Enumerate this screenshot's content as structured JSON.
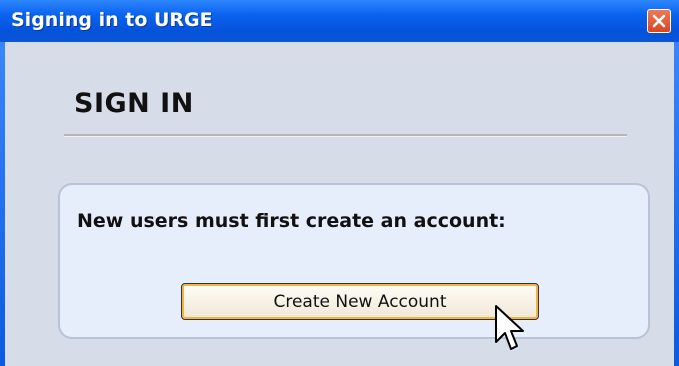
{
  "window": {
    "title": "Signing in to URGE"
  },
  "signin": {
    "heading": "SIGN IN",
    "prompt": "New users must first create an account:",
    "create_button_label": "Create New Account"
  },
  "icons": {
    "close": "close-icon",
    "cursor": "mouse-pointer-icon"
  },
  "colors": {
    "titlebar": "#0a63ee",
    "client_background": "#d6dde8",
    "panel_background": "#e7eefb",
    "button_focus_highlight": "#f0b344",
    "close_button": "#d8451f"
  }
}
